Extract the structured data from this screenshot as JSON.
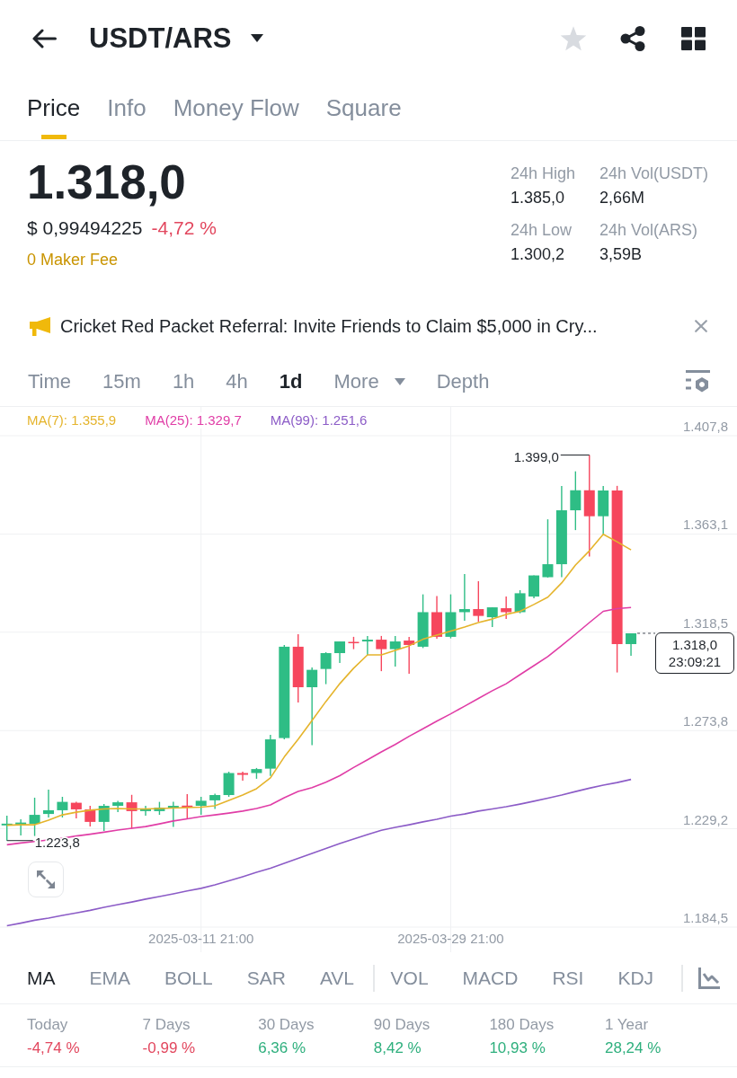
{
  "header": {
    "title": "USDT/ARS",
    "starred": false
  },
  "tabs": [
    {
      "label": "Price",
      "selected": true
    },
    {
      "label": "Info",
      "selected": false
    },
    {
      "label": "Money Flow",
      "selected": false
    },
    {
      "label": "Square",
      "selected": false
    }
  ],
  "ticker": {
    "price": "1.318,0",
    "usd_price": "$ 0,99494225",
    "change": "-4,72 %",
    "color": "#e2475e",
    "fee_note": "0 Maker Fee",
    "stats": [
      {
        "label": "24h High",
        "value": "1.385,0"
      },
      {
        "label": "24h Vol(USDT)",
        "value": "2,66M"
      },
      {
        "label": "24h Low",
        "value": "1.300,2"
      },
      {
        "label": "24h Vol(ARS)",
        "value": "3,59B"
      }
    ]
  },
  "announcement": {
    "text": "Cricket Red Packet Referral: Invite Friends to Claim $5,000 in Cry..."
  },
  "intervals": [
    {
      "label": "Time",
      "kind": "option",
      "selected": false
    },
    {
      "label": "15m",
      "kind": "option",
      "selected": false
    },
    {
      "label": "1h",
      "kind": "option",
      "selected": false
    },
    {
      "label": "4h",
      "kind": "option",
      "selected": false
    },
    {
      "label": "1d",
      "kind": "option",
      "selected": true
    },
    {
      "label": "More",
      "kind": "menu",
      "selected": false
    },
    {
      "label": "Depth",
      "kind": "option",
      "selected": false
    }
  ],
  "chart": {
    "price_tag": {
      "price": "1.318,0",
      "countdown": "23:09:21"
    },
    "chart_data": {
      "type": "candlestick",
      "grid": true,
      "categories": [
        null,
        null,
        null,
        null,
        null,
        null,
        null,
        null,
        null,
        null,
        null,
        null,
        null,
        null,
        "2025-03-11 21:00",
        null,
        null,
        null,
        null,
        null,
        null,
        null,
        null,
        null,
        null,
        null,
        null,
        null,
        null,
        null,
        null,
        null,
        "2025-03-29 21:00",
        null,
        null,
        null,
        null,
        null,
        null,
        null,
        null,
        null,
        null,
        null,
        null,
        null
      ],
      "ylim": [
        1184.5,
        1407.8
      ],
      "yticks": [
        {
          "value": 1407.8,
          "label": "1.407,8"
        },
        {
          "value": 1363.1,
          "label": "1.363,1"
        },
        {
          "value": 1318.5,
          "label": "1.318,5"
        },
        {
          "value": 1273.8,
          "label": "1.273,8"
        },
        {
          "value": 1229.2,
          "label": "1.229,2"
        },
        {
          "value": 1184.5,
          "label": "1.184,5"
        }
      ],
      "ohlc": [
        [
          1230.7,
          1235.1,
          1223.8,
          1231.5
        ],
        [
          1231.1,
          1233.5,
          1226.1,
          1232.0
        ],
        [
          1231.4,
          1243.3,
          1225.9,
          1235.5
        ],
        [
          1235.9,
          1247.0,
          1234.3,
          1237.6
        ],
        [
          1237.6,
          1243.7,
          1234.3,
          1241.4
        ],
        [
          1241.0,
          1241.4,
          1233.9,
          1238.0
        ],
        [
          1238.0,
          1239.6,
          1230.2,
          1232.3
        ],
        [
          1232.3,
          1240.4,
          1228.2,
          1239.6
        ],
        [
          1239.6,
          1241.9,
          1236.8,
          1241.2
        ],
        [
          1241.2,
          1244.6,
          1229.2,
          1237.2
        ],
        [
          1237.2,
          1239.6,
          1235.1,
          1238.4
        ],
        [
          1237.2,
          1241.4,
          1235.5,
          1238.8
        ],
        [
          1238.4,
          1241.4,
          1230.0,
          1239.6
        ],
        [
          1239.7,
          1244.9,
          1233.9,
          1238.8
        ],
        [
          1239.6,
          1243.7,
          1235.5,
          1241.9
        ],
        [
          1242.1,
          1245.1,
          1238.2,
          1244.5
        ],
        [
          1244.5,
          1255.1,
          1243.7,
          1254.5
        ],
        [
          1254.5,
          1255.1,
          1251.0,
          1253.7
        ],
        [
          1254.5,
          1256.8,
          1251.9,
          1256.3
        ],
        [
          1256.5,
          1271.9,
          1253.2,
          1269.8
        ],
        [
          1270.4,
          1312.7,
          1269.8,
          1311.9
        ],
        [
          1311.9,
          1317.6,
          1286.6,
          1293.5
        ],
        [
          1293.5,
          1302.5,
          1267.2,
          1301.4
        ],
        [
          1301.8,
          1309.4,
          1294.9,
          1309.0
        ],
        [
          1309.0,
          1314.3,
          1304.5,
          1314.3
        ],
        [
          1314.1,
          1316.4,
          1310.8,
          1313.5
        ],
        [
          1314.3,
          1316.8,
          1308.2,
          1315.1
        ],
        [
          1315.1,
          1316.8,
          1300.8,
          1310.8
        ],
        [
          1310.8,
          1316.8,
          1302.9,
          1314.3
        ],
        [
          1314.7,
          1316.4,
          1299.6,
          1312.7
        ],
        [
          1311.9,
          1335.7,
          1311.3,
          1327.6
        ],
        [
          1327.6,
          1334.9,
          1315.5,
          1316.4
        ],
        [
          1316.4,
          1335.7,
          1315.7,
          1327.6
        ],
        [
          1327.6,
          1344.9,
          1323.7,
          1329.0
        ],
        [
          1329.0,
          1341.7,
          1323.3,
          1325.9
        ],
        [
          1325.3,
          1329.8,
          1320.8,
          1329.8
        ],
        [
          1329.4,
          1334.7,
          1324.5,
          1327.6
        ],
        [
          1327.6,
          1337.6,
          1327.1,
          1336.2
        ],
        [
          1334.7,
          1344.3,
          1333.9,
          1344.3
        ],
        [
          1343.5,
          1369.8,
          1343.3,
          1349.4
        ],
        [
          1349.4,
          1384.9,
          1343.5,
          1373.9
        ],
        [
          1373.9,
          1391.6,
          1364.9,
          1383.0
        ],
        [
          1383.0,
          1399.0,
          1352.9,
          1371.2
        ],
        [
          1371.2,
          1384.9,
          1363.0,
          1382.9
        ],
        [
          1382.9,
          1385.0,
          1300.2,
          1313.1
        ],
        [
          1313.1,
          1318.0,
          1307.8,
          1318.0
        ]
      ],
      "series": [
        {
          "name": "MA(7): 1.355,9",
          "type": "line",
          "color": "#e5b42c",
          "values": [
            1230.8,
            1231.0,
            1231.0,
            1233.1,
            1235.5,
            1236.7,
            1237.6,
            1238.2,
            1238.4,
            1238.2,
            1238.2,
            1238.4,
            1238.6,
            1238.8,
            1239.0,
            1239.6,
            1242.1,
            1244.5,
            1247.4,
            1252.3,
            1261.8,
            1269.8,
            1278.4,
            1287.0,
            1295.1,
            1302.1,
            1308.2,
            1308.2,
            1310.2,
            1312.3,
            1315.3,
            1317.2,
            1319.0,
            1320.8,
            1322.9,
            1324.5,
            1326.6,
            1328.0,
            1331.1,
            1334.4,
            1340.9,
            1349.0,
            1355.5,
            1363.0,
            1359.6,
            1355.9
          ]
        },
        {
          "name": "MA(25): 1.329,7",
          "type": "line",
          "color": "#e03da6",
          "values": [
            1221.9,
            1222.7,
            1223.4,
            1224.1,
            1224.9,
            1225.9,
            1226.7,
            1227.6,
            1228.6,
            1229.4,
            1230.2,
            1231.4,
            1232.7,
            1233.7,
            1234.7,
            1235.5,
            1236.3,
            1237.2,
            1238.4,
            1240.0,
            1243.3,
            1246.1,
            1247.9,
            1250.3,
            1253.3,
            1257.0,
            1260.5,
            1264.1,
            1267.5,
            1271.2,
            1274.6,
            1278.1,
            1281.4,
            1284.9,
            1288.4,
            1291.9,
            1295.1,
            1299.2,
            1303.3,
            1307.4,
            1312.4,
            1317.6,
            1322.9,
            1328.0,
            1329.2,
            1329.7
          ]
        },
        {
          "name": "MA(99): 1.251,6",
          "type": "line",
          "color": "#8c5cc7",
          "values": [
            1185.1,
            1186.3,
            1187.6,
            1188.6,
            1189.8,
            1190.9,
            1192.1,
            1193.5,
            1194.7,
            1195.9,
            1197.2,
            1198.4,
            1199.6,
            1200.9,
            1202.1,
            1203.7,
            1205.5,
            1207.4,
            1209.4,
            1211.2,
            1213.5,
            1215.7,
            1218.0,
            1220.2,
            1222.5,
            1224.5,
            1226.5,
            1228.5,
            1229.8,
            1231.0,
            1232.3,
            1233.5,
            1234.9,
            1235.9,
            1237.2,
            1238.2,
            1239.2,
            1240.4,
            1241.7,
            1243.1,
            1244.5,
            1246.1,
            1247.6,
            1249.0,
            1250.2,
            1251.6
          ]
        }
      ],
      "annotations": [
        "1.399,0",
        "1.223,8"
      ]
    }
  },
  "indicators": {
    "main": [
      {
        "label": "MA",
        "selected": true
      },
      {
        "label": "EMA",
        "selected": false
      },
      {
        "label": "BOLL",
        "selected": false
      },
      {
        "label": "SAR",
        "selected": false
      },
      {
        "label": "AVL",
        "selected": false
      }
    ],
    "sub": [
      {
        "label": "VOL",
        "selected": false
      },
      {
        "label": "MACD",
        "selected": false
      },
      {
        "label": "RSI",
        "selected": false
      },
      {
        "label": "KDJ",
        "selected": false
      }
    ]
  },
  "performance": [
    {
      "label": "Today",
      "value": "-4,74 %",
      "color": "#e2475e"
    },
    {
      "label": "7 Days",
      "value": "-0,99 %",
      "color": "#e2475e"
    },
    {
      "label": "30 Days",
      "value": "6,36 %",
      "color": "#2eaf7d"
    },
    {
      "label": "90 Days",
      "value": "8,42 %",
      "color": "#2eaf7d"
    },
    {
      "label": "180 Days",
      "value": "10,93 %",
      "color": "#2eaf7d"
    },
    {
      "label": "1 Year",
      "value": "28,24 %",
      "color": "#2eaf7d"
    }
  ]
}
